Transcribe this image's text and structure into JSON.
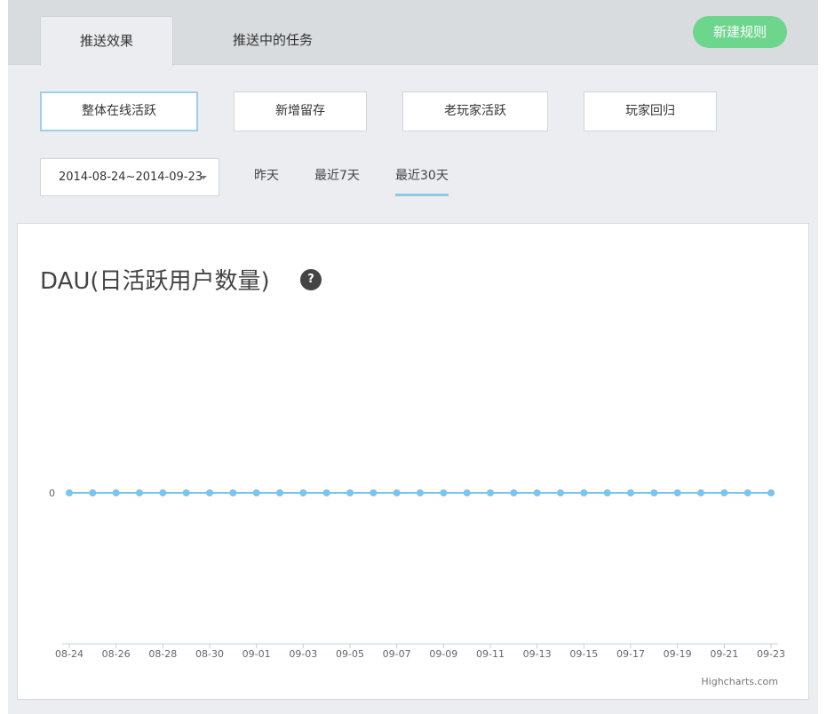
{
  "tabs": [
    {
      "label": "推送效果",
      "active": true
    },
    {
      "label": "推送中的任务",
      "active": false
    }
  ],
  "new_rule_label": "新建规则",
  "segments": [
    {
      "label": "整体在线活跃",
      "active": true
    },
    {
      "label": "新增留存",
      "active": false
    },
    {
      "label": "老玩家活跃",
      "active": false
    },
    {
      "label": "玩家回归",
      "active": false
    }
  ],
  "date_range": "2014-08-24~2014-09-23",
  "quick_ranges": [
    {
      "label": "昨天",
      "active": false
    },
    {
      "label": "最近7天",
      "active": false
    },
    {
      "label": "最近30天",
      "active": true
    }
  ],
  "help_label": "?",
  "credit": "Highcharts.com",
  "colors": {
    "series": "#7cc4ec",
    "accent_green": "#6ed58d"
  },
  "chart_data": {
    "type": "line",
    "title": "DAU(日活跃用户数量)",
    "x": [
      "08-24",
      "08-25",
      "08-26",
      "08-27",
      "08-28",
      "08-29",
      "08-30",
      "08-31",
      "09-01",
      "09-02",
      "09-03",
      "09-04",
      "09-05",
      "09-06",
      "09-07",
      "09-08",
      "09-09",
      "09-10",
      "09-11",
      "09-12",
      "09-13",
      "09-14",
      "09-15",
      "09-16",
      "09-17",
      "09-18",
      "09-19",
      "09-20",
      "09-21",
      "09-22",
      "09-23"
    ],
    "xticks": [
      "08-24",
      "08-26",
      "08-28",
      "08-30",
      "09-01",
      "09-03",
      "09-05",
      "09-07",
      "09-09",
      "09-11",
      "09-13",
      "09-15",
      "09-17",
      "09-19",
      "09-21",
      "09-23"
    ],
    "series": [
      {
        "values": [
          0,
          0,
          0,
          0,
          0,
          0,
          0,
          0,
          0,
          0,
          0,
          0,
          0,
          0,
          0,
          0,
          0,
          0,
          0,
          0,
          0,
          0,
          0,
          0,
          0,
          0,
          0,
          0,
          0,
          0,
          0
        ]
      }
    ],
    "yticks": [
      "0"
    ],
    "grid": false
  }
}
